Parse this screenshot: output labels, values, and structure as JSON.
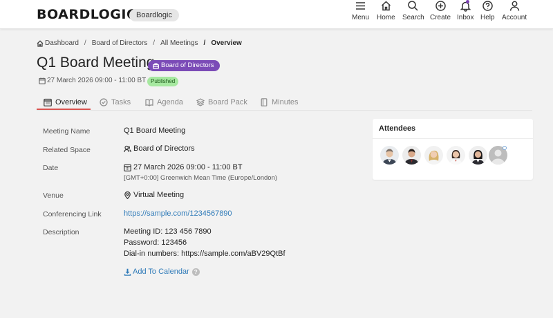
{
  "header": {
    "logo": "BOARDLOGIC",
    "org_name": "Boardlogic",
    "nav": [
      {
        "label": "Menu",
        "icon": "menu-icon"
      },
      {
        "label": "Home",
        "icon": "home-icon"
      },
      {
        "label": "Search",
        "icon": "search-icon"
      },
      {
        "label": "Create",
        "icon": "plus-circle-icon"
      },
      {
        "label": "Inbox",
        "icon": "bell-icon"
      },
      {
        "label": "Help",
        "icon": "help-icon"
      },
      {
        "label": "Account",
        "icon": "user-icon"
      }
    ]
  },
  "breadcrumb": {
    "items": [
      "Dashboard",
      "Board of Directors",
      "All Meetings"
    ],
    "current": "Overview",
    "sep": "/"
  },
  "meeting": {
    "title": "Q1 Board Meeting",
    "space_badge": "Board of Directors",
    "dateline": "27 March 2026 09:00 - 11:00 BT",
    "status": "Published"
  },
  "tabs": [
    "Overview",
    "Tasks",
    "Agenda",
    "Board Pack",
    "Minutes"
  ],
  "details": {
    "meeting_name_label": "Meeting Name",
    "meeting_name_value": "Q1 Board Meeting",
    "related_space_label": "Related Space",
    "related_space_value": "Board of Directors",
    "date_label": "Date",
    "date_value": "27 March 2026 09:00 - 11:00 BT",
    "date_timezone": "[GMT+0:00] Greenwich Mean Time (Europe/London)",
    "venue_label": "Venue",
    "venue_value": "Virtual Meeting",
    "conf_label": "Conferencing Link",
    "conf_value": "https://sample.com/1234567890",
    "description_label": "Description",
    "description_lines": [
      "Meeting ID: 123 456 7890",
      "Password: 123456",
      "Dial-in numbers: https://sample.com/aBV29QtBf"
    ],
    "add_to_calendar": "Add To Calendar",
    "help_glyph": "?"
  },
  "attendees": {
    "title": "Attendees",
    "count": 6
  },
  "colors": {
    "accent_underline": "#d9534f",
    "space_badge": "#7b4bb7",
    "status_green": "#a6e8a0",
    "link": "#2e7ab8"
  }
}
